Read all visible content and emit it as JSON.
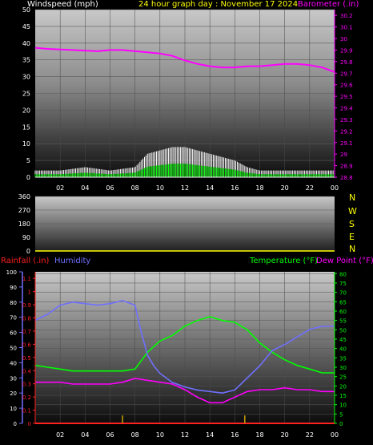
{
  "header": {
    "windspeed_label": "Windspeed (mph)",
    "title": "24 hour graph day : November 17 2024",
    "barometer_label": "Barometer (.in)"
  },
  "middle": {
    "compass": [
      "N",
      "W",
      "S",
      "E",
      "N"
    ]
  },
  "bottom_header": {
    "rainfall_label": "Rainfall (.in)",
    "humidity_label": "Humidity",
    "temperature_label": "Temperature (°F)",
    "dewpoint_label": "Dew Point (°F)"
  },
  "colors": {
    "windspeed": "#ffffff",
    "gust": "#00ff00",
    "barometer": "#ff00ff",
    "title": "#ffff00",
    "rainfall": "#ff2020",
    "humidity": "#7070ff",
    "temperature": "#00ff00",
    "dewpoint": "#ff00ff",
    "rain_bars": "#c8a000"
  },
  "chart_data": [
    {
      "type": "line",
      "title": "24 hour graph day : November 17 2024",
      "x_ticks": [
        "02",
        "04",
        "06",
        "08",
        "10",
        "12",
        "14",
        "16",
        "18",
        "20",
        "22",
        "00"
      ],
      "ylabel": "Windspeed (mph)",
      "y_ticks": [
        0,
        5,
        10,
        15,
        20,
        25,
        30,
        35,
        40,
        45,
        50
      ],
      "ylim": [
        0,
        50
      ],
      "y2label": "Barometer (.in)",
      "y2_ticks": [
        "28.8",
        "28.9",
        "29",
        "29.1",
        "29.2",
        "29.3",
        "29.4",
        "29.5",
        "29.6",
        "29.7",
        "29.8",
        "29.9",
        "30",
        "30.1",
        "30.2"
      ],
      "y2lim": [
        28.8,
        30.25
      ],
      "series": [
        {
          "name": "Windspeed",
          "axis": "y",
          "x": [
            0,
            2,
            4,
            6,
            8,
            9,
            10,
            11,
            12,
            13,
            14,
            16,
            17,
            18,
            20,
            22,
            24
          ],
          "values": [
            2,
            2,
            3,
            2,
            3,
            7,
            8,
            9,
            9,
            8,
            7,
            5,
            3,
            2,
            2,
            2,
            2
          ]
        },
        {
          "name": "Barometer",
          "axis": "y2",
          "x": [
            0,
            1,
            3,
            5,
            6,
            7,
            8,
            9,
            10,
            11,
            12,
            13,
            14,
            15,
            16,
            17,
            18,
            19,
            20,
            21,
            22,
            23,
            24
          ],
          "values": [
            29.92,
            29.91,
            29.9,
            29.89,
            29.9,
            29.9,
            29.89,
            29.88,
            29.87,
            29.85,
            29.81,
            29.78,
            29.76,
            29.75,
            29.75,
            29.76,
            29.76,
            29.77,
            29.78,
            29.78,
            29.77,
            29.75,
            29.71
          ]
        }
      ]
    },
    {
      "type": "line",
      "y_ticks": [
        0,
        90,
        180,
        270,
        360
      ],
      "ylim": [
        0,
        360
      ],
      "series": []
    },
    {
      "type": "line",
      "x_ticks": [
        "02",
        "04",
        "06",
        "08",
        "10",
        "12",
        "14",
        "16",
        "18",
        "20",
        "22",
        "00"
      ],
      "humidity_ticks": [
        0,
        10,
        20,
        30,
        40,
        50,
        60,
        70,
        80,
        90,
        100
      ],
      "humidity_lim": [
        0,
        100
      ],
      "rain_ticks": [
        "0",
        "0.1",
        "0.2",
        "0.3",
        "0.4",
        "0.5",
        "0.6",
        "0.7",
        "0.8",
        "0.9",
        "1",
        "1.1"
      ],
      "rain_lim": [
        0,
        1.15
      ],
      "temp_ticks": [
        0,
        5,
        10,
        15,
        20,
        25,
        30,
        35,
        40,
        45,
        50,
        55,
        60,
        65,
        70,
        75,
        80
      ],
      "temp_lim": [
        0,
        81
      ],
      "series": [
        {
          "name": "Humidity",
          "axis": "humidity",
          "x": [
            0,
            1,
            2,
            3,
            4,
            5,
            6,
            7,
            8,
            8.5,
            9,
            9.5,
            10,
            11,
            12,
            13,
            14,
            15,
            16,
            17,
            18,
            19,
            20,
            21,
            22,
            23,
            24
          ],
          "values": [
            68,
            72,
            78,
            80,
            79,
            78,
            79,
            81,
            78,
            60,
            45,
            38,
            33,
            27,
            24,
            22,
            21,
            20,
            22,
            30,
            38,
            48,
            52,
            57,
            62,
            64,
            64
          ]
        },
        {
          "name": "Temperature",
          "axis": "temp",
          "x": [
            0,
            1,
            2,
            3,
            4,
            5,
            6,
            7,
            8,
            9,
            10,
            11,
            12,
            13,
            14,
            15,
            16,
            17,
            18,
            19,
            20,
            21,
            22,
            23,
            24
          ],
          "values": [
            31,
            30,
            29,
            28,
            28,
            28,
            28,
            28,
            29,
            38,
            44,
            47,
            52,
            55,
            57,
            55,
            54,
            50,
            43,
            38,
            34,
            31,
            29,
            27,
            27
          ]
        },
        {
          "name": "Dew Point",
          "axis": "temp",
          "x": [
            0,
            1,
            2,
            3,
            4,
            5,
            6,
            7,
            8,
            9,
            10,
            11,
            12,
            13,
            14,
            15,
            16,
            17,
            18,
            19,
            20,
            21,
            22,
            23,
            24
          ],
          "values": [
            22,
            22,
            22,
            21,
            21,
            21,
            21,
            22,
            24,
            23,
            22,
            21,
            18,
            14,
            11,
            11,
            14,
            17,
            18,
            18,
            19,
            18,
            18,
            17,
            17
          ]
        },
        {
          "name": "Rainfall",
          "axis": "rain",
          "x": [
            0,
            24
          ],
          "values": [
            0,
            0
          ]
        }
      ],
      "rain_events": [
        {
          "x": 7.0,
          "value": 0.06
        },
        {
          "x": 16.8,
          "value": 0.06
        }
      ]
    }
  ]
}
